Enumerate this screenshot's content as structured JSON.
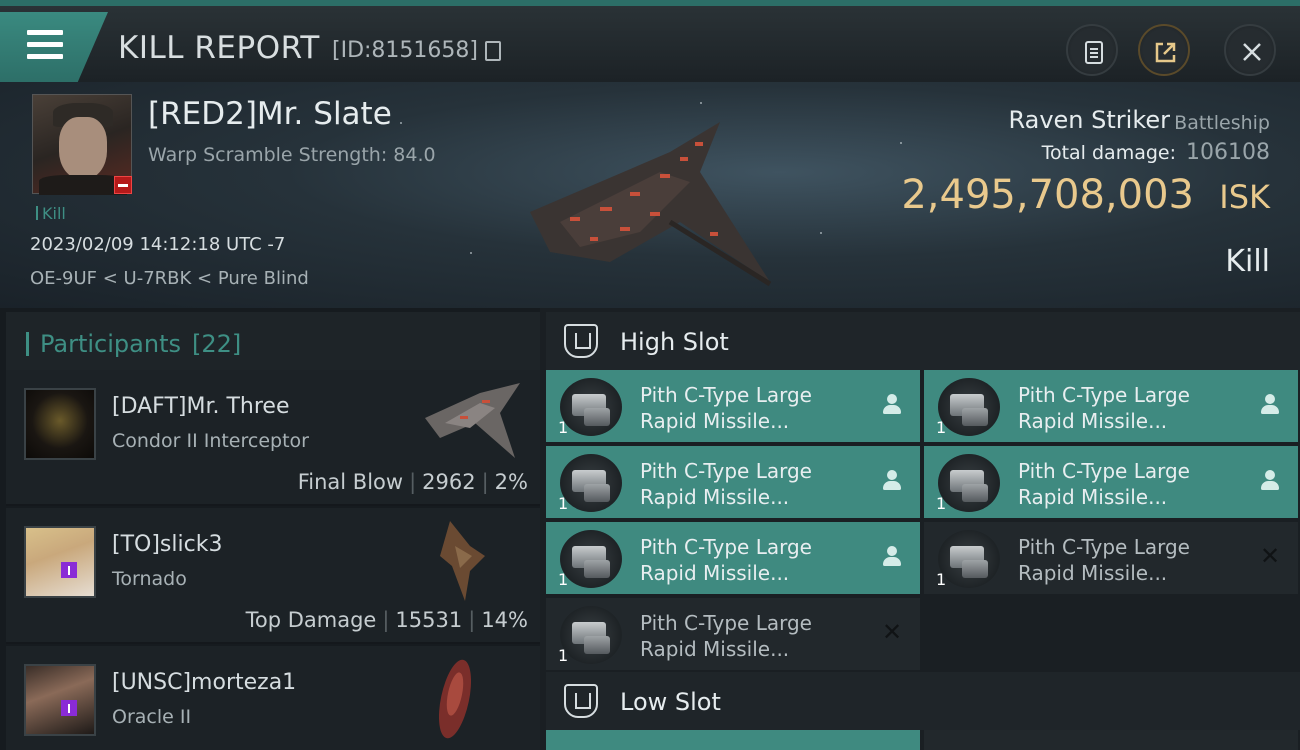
{
  "titlebar": {
    "title": "KILL REPORT",
    "id_text": "[ID:8151658]",
    "icons": [
      "menu-icon",
      "copy-icon",
      "clipboard-icon",
      "share-icon",
      "close-icon"
    ]
  },
  "victim": {
    "name": "[RED2]Mr. Slate",
    "warp_scramble": "Warp Scramble Strength: 84.0",
    "tag": "Kill",
    "datetime": "2023/02/09 14:12:18 UTC -7",
    "location": "OE-9UF < U-7RBK < Pure Blind",
    "ship_name": "Raven Striker",
    "ship_class": "Battleship",
    "total_damage_label": "Total damage:",
    "total_damage": "106108",
    "isk_value": "2,495,708,003",
    "isk_unit": "ISK",
    "result": "Kill"
  },
  "participants": {
    "title": "Participants",
    "count": "[22]",
    "rows": [
      {
        "name": "[DAFT]Mr. Three",
        "ship": "Condor II Interceptor",
        "label": "Final Blow",
        "damage": "2962",
        "percent": "2%"
      },
      {
        "name": "[TO]slick3",
        "ship": "Tornado",
        "label": "Top Damage",
        "damage": "15531",
        "percent": "14%"
      },
      {
        "name": "[UNSC]morteza1",
        "ship": "Oracle II",
        "label": "",
        "damage": "",
        "percent": ""
      }
    ]
  },
  "fitting": {
    "high_slot_title": "High Slot",
    "low_slot_title": "Low Slot",
    "modules": [
      {
        "line1": "Pith C-Type Large",
        "line2": "Rapid Missile...",
        "qty": "1",
        "status": "dropped"
      },
      {
        "line1": "Pith C-Type Large",
        "line2": "Rapid Missile...",
        "qty": "1",
        "status": "dropped"
      },
      {
        "line1": "Pith C-Type Large",
        "line2": "Rapid Missile...",
        "qty": "1",
        "status": "dropped"
      },
      {
        "line1": "Pith C-Type Large",
        "line2": "Rapid Missile...",
        "qty": "1",
        "status": "dropped"
      },
      {
        "line1": "Pith C-Type Large",
        "line2": "Rapid Missile...",
        "qty": "1",
        "status": "dropped"
      },
      {
        "line1": "Pith C-Type Large",
        "line2": "Rapid Missile...",
        "qty": "1",
        "status": "destroyed"
      },
      {
        "line1": "Pith C-Type Large",
        "line2": "Rapid Missile...",
        "qty": "1",
        "status": "destroyed"
      }
    ]
  },
  "colors": {
    "accent_teal": "#3f8a80",
    "isk_gold": "#e9c98d",
    "badge_red": "#b51a1a",
    "badge_purple": "#8a2bd6"
  }
}
